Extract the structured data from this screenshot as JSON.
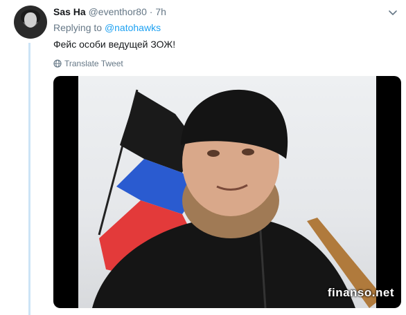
{
  "tweet": {
    "display_name": "Sas Ha",
    "handle": "@eventhor80",
    "separator": "·",
    "time": "7h",
    "replying_to_prefix": "Replying to ",
    "replying_to_handle": "@natohawks",
    "text": "Фейс особи ведущей ЗОЖ!",
    "translate_label": "Translate Tweet"
  },
  "media": {
    "watermark": "finanso.net"
  },
  "icons": {
    "avatar": "avatar",
    "more": "chevron-down-icon",
    "translate": "globe-icon"
  },
  "colors": {
    "link": "#1da1f2",
    "secondary_text": "#657786",
    "thread_line": "#cce4f6"
  }
}
